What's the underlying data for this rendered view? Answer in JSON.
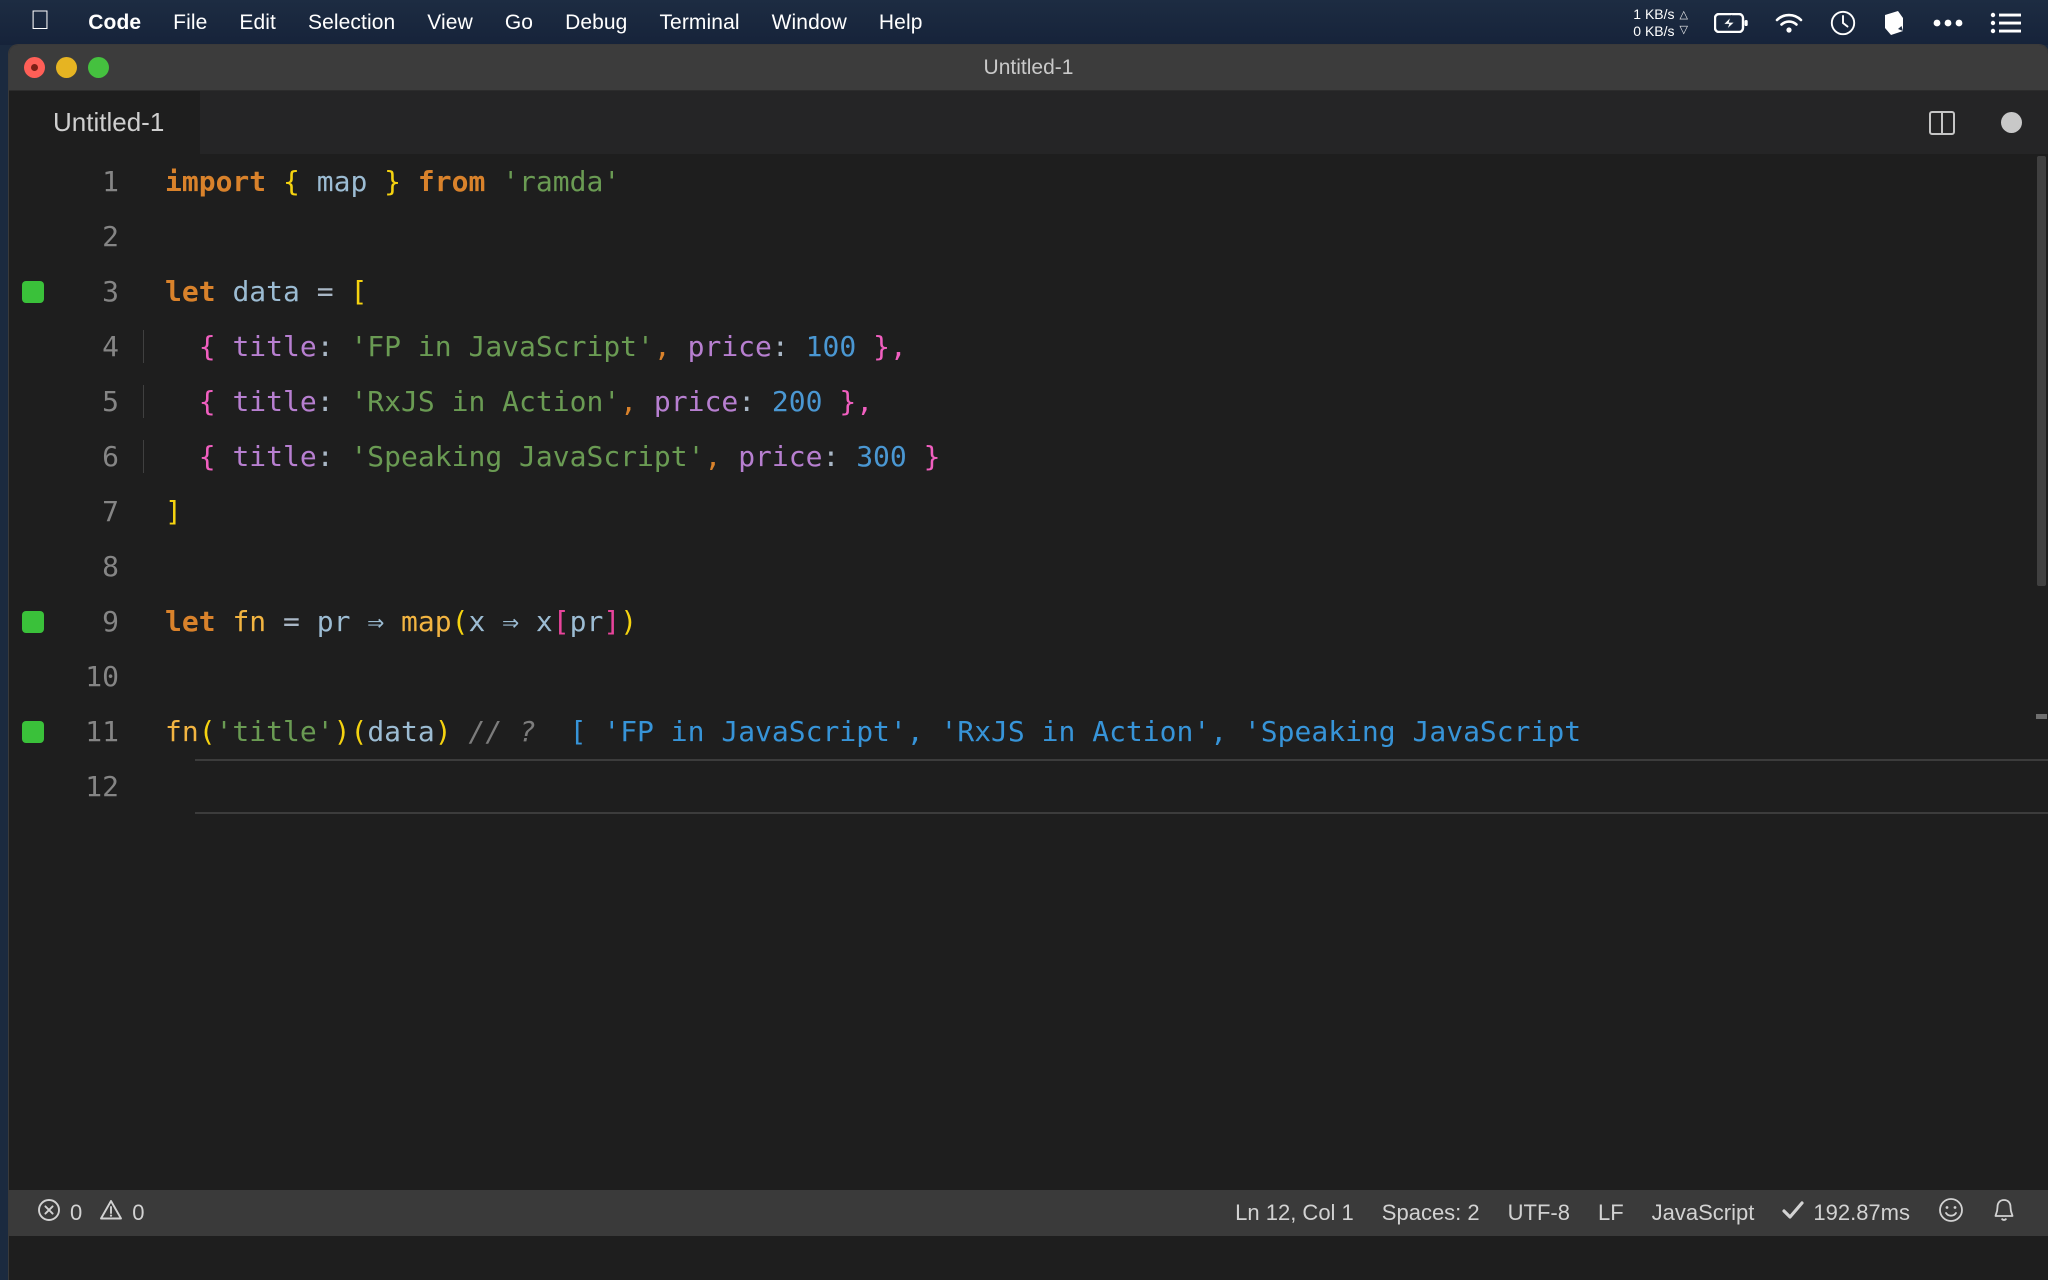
{
  "menubar": {
    "apple_icon": "apple-logo-icon",
    "items": [
      {
        "label": "Code",
        "bold": true
      },
      {
        "label": "File",
        "bold": false
      },
      {
        "label": "Edit",
        "bold": false
      },
      {
        "label": "Selection",
        "bold": false
      },
      {
        "label": "View",
        "bold": false
      },
      {
        "label": "Go",
        "bold": false
      },
      {
        "label": "Debug",
        "bold": false
      },
      {
        "label": "Terminal",
        "bold": false
      },
      {
        "label": "Window",
        "bold": false
      },
      {
        "label": "Help",
        "bold": false
      }
    ],
    "network": {
      "upload": "1 KB/s",
      "download": "0 KB/s",
      "up_arrow": "△",
      "down_arrow": "▽"
    },
    "tray_icons": [
      "battery-charging-icon",
      "wifi-icon",
      "clock-icon",
      "cube-icon",
      "ellipsis-icon",
      "list-menu-icon"
    ]
  },
  "window": {
    "title": "Untitled-1",
    "traffic_lights": [
      "close-button",
      "minimize-button",
      "zoom-button"
    ]
  },
  "tabs": {
    "active": "Untitled-1",
    "actions": [
      "split-editor-icon",
      "unsaved-indicator"
    ]
  },
  "editor": {
    "lines": [
      {
        "num": "1",
        "breakpoint": false,
        "indent_guide": false,
        "tokens": [
          {
            "text": "import",
            "cls": "t-kw"
          },
          {
            "text": " ",
            "cls": "t-punct"
          },
          {
            "text": "{",
            "cls": "t-brace-y"
          },
          {
            "text": " ",
            "cls": "t-punct"
          },
          {
            "text": "map",
            "cls": "t-var"
          },
          {
            "text": " ",
            "cls": "t-punct"
          },
          {
            "text": "}",
            "cls": "t-brace-y"
          },
          {
            "text": " ",
            "cls": "t-punct"
          },
          {
            "text": "from",
            "cls": "t-kw"
          },
          {
            "text": " ",
            "cls": "t-punct"
          },
          {
            "text": "'ramda'",
            "cls": "t-str"
          }
        ]
      },
      {
        "num": "2",
        "breakpoint": false,
        "indent_guide": false,
        "tokens": []
      },
      {
        "num": "3",
        "breakpoint": true,
        "indent_guide": false,
        "tokens": [
          {
            "text": "let",
            "cls": "t-kw"
          },
          {
            "text": " ",
            "cls": "t-punct"
          },
          {
            "text": "data",
            "cls": "t-var"
          },
          {
            "text": " ",
            "cls": "t-punct"
          },
          {
            "text": "=",
            "cls": "t-punct"
          },
          {
            "text": " ",
            "cls": "t-punct"
          },
          {
            "text": "[",
            "cls": "t-brace-y"
          }
        ]
      },
      {
        "num": "4",
        "breakpoint": false,
        "indent_guide": true,
        "tokens": [
          {
            "text": "  ",
            "cls": "t-punct"
          },
          {
            "text": "{",
            "cls": "t-brace-p"
          },
          {
            "text": " ",
            "cls": "t-punct"
          },
          {
            "text": "title",
            "cls": "t-prop"
          },
          {
            "text": ":",
            "cls": "t-punct"
          },
          {
            "text": " ",
            "cls": "t-punct"
          },
          {
            "text": "'FP in JavaScript'",
            "cls": "t-str"
          },
          {
            "text": ",",
            "cls": "t-comma-o"
          },
          {
            "text": " ",
            "cls": "t-punct"
          },
          {
            "text": "price",
            "cls": "t-prop"
          },
          {
            "text": ":",
            "cls": "t-punct"
          },
          {
            "text": " ",
            "cls": "t-punct"
          },
          {
            "text": "100",
            "cls": "t-num"
          },
          {
            "text": " ",
            "cls": "t-punct"
          },
          {
            "text": "}",
            "cls": "t-brace-p"
          },
          {
            "text": ",",
            "cls": "t-brace-p"
          }
        ]
      },
      {
        "num": "5",
        "breakpoint": false,
        "indent_guide": true,
        "tokens": [
          {
            "text": "  ",
            "cls": "t-punct"
          },
          {
            "text": "{",
            "cls": "t-brace-p"
          },
          {
            "text": " ",
            "cls": "t-punct"
          },
          {
            "text": "title",
            "cls": "t-prop"
          },
          {
            "text": ":",
            "cls": "t-punct"
          },
          {
            "text": " ",
            "cls": "t-punct"
          },
          {
            "text": "'RxJS in Action'",
            "cls": "t-str"
          },
          {
            "text": ",",
            "cls": "t-comma-o"
          },
          {
            "text": " ",
            "cls": "t-punct"
          },
          {
            "text": "price",
            "cls": "t-prop"
          },
          {
            "text": ":",
            "cls": "t-punct"
          },
          {
            "text": " ",
            "cls": "t-punct"
          },
          {
            "text": "200",
            "cls": "t-num"
          },
          {
            "text": " ",
            "cls": "t-punct"
          },
          {
            "text": "}",
            "cls": "t-brace-p"
          },
          {
            "text": ",",
            "cls": "t-brace-p"
          }
        ]
      },
      {
        "num": "6",
        "breakpoint": false,
        "indent_guide": true,
        "tokens": [
          {
            "text": "  ",
            "cls": "t-punct"
          },
          {
            "text": "{",
            "cls": "t-brace-p"
          },
          {
            "text": " ",
            "cls": "t-punct"
          },
          {
            "text": "title",
            "cls": "t-prop"
          },
          {
            "text": ":",
            "cls": "t-punct"
          },
          {
            "text": " ",
            "cls": "t-punct"
          },
          {
            "text": "'Speaking JavaScript'",
            "cls": "t-str"
          },
          {
            "text": ",",
            "cls": "t-comma-o"
          },
          {
            "text": " ",
            "cls": "t-punct"
          },
          {
            "text": "price",
            "cls": "t-prop"
          },
          {
            "text": ":",
            "cls": "t-punct"
          },
          {
            "text": " ",
            "cls": "t-punct"
          },
          {
            "text": "300",
            "cls": "t-num"
          },
          {
            "text": " ",
            "cls": "t-punct"
          },
          {
            "text": "}",
            "cls": "t-brace-p"
          }
        ]
      },
      {
        "num": "7",
        "breakpoint": false,
        "indent_guide": false,
        "tokens": [
          {
            "text": "]",
            "cls": "t-brace-y"
          }
        ]
      },
      {
        "num": "8",
        "breakpoint": false,
        "indent_guide": false,
        "tokens": []
      },
      {
        "num": "9",
        "breakpoint": true,
        "indent_guide": false,
        "tokens": [
          {
            "text": "let",
            "cls": "t-kw"
          },
          {
            "text": " ",
            "cls": "t-punct"
          },
          {
            "text": "fn",
            "cls": "t-fn"
          },
          {
            "text": " ",
            "cls": "t-punct"
          },
          {
            "text": "=",
            "cls": "t-punct"
          },
          {
            "text": " ",
            "cls": "t-punct"
          },
          {
            "text": "pr",
            "cls": "t-var"
          },
          {
            "text": " ",
            "cls": "t-punct"
          },
          {
            "text": "⇒",
            "cls": "t-var"
          },
          {
            "text": " ",
            "cls": "t-punct"
          },
          {
            "text": "map",
            "cls": "t-fn"
          },
          {
            "text": "(",
            "cls": "t-brace-y"
          },
          {
            "text": "x",
            "cls": "t-var"
          },
          {
            "text": " ",
            "cls": "t-punct"
          },
          {
            "text": "⇒",
            "cls": "t-var"
          },
          {
            "text": " ",
            "cls": "t-punct"
          },
          {
            "text": "x",
            "cls": "t-var"
          },
          {
            "text": "[",
            "cls": "t-brace-m"
          },
          {
            "text": "pr",
            "cls": "t-var"
          },
          {
            "text": "]",
            "cls": "t-brace-m"
          },
          {
            "text": ")",
            "cls": "t-brace-y"
          }
        ]
      },
      {
        "num": "10",
        "breakpoint": false,
        "indent_guide": false,
        "tokens": []
      },
      {
        "num": "11",
        "breakpoint": true,
        "indent_guide": false,
        "tokens": [
          {
            "text": "fn",
            "cls": "t-fn"
          },
          {
            "text": "(",
            "cls": "t-brace-y"
          },
          {
            "text": "'title'",
            "cls": "t-str"
          },
          {
            "text": ")",
            "cls": "t-brace-y"
          },
          {
            "text": "(",
            "cls": "t-brace-y"
          },
          {
            "text": "data",
            "cls": "t-var"
          },
          {
            "text": ")",
            "cls": "t-brace-y"
          },
          {
            "text": " ",
            "cls": "t-punct"
          },
          {
            "text": "// ?",
            "cls": "t-comment"
          },
          {
            "text": "  ",
            "cls": "t-punct"
          },
          {
            "text": "[ 'FP in JavaScript', 'RxJS in Action', 'Speaking JavaScript",
            "cls": "t-result"
          }
        ]
      },
      {
        "num": "12",
        "breakpoint": false,
        "indent_guide": false,
        "cursor_line": true,
        "tokens": []
      }
    ]
  },
  "statusbar": {
    "errors_icon": "error-circle-icon",
    "errors": "0",
    "warnings_icon": "warning-triangle-icon",
    "warnings": "0",
    "cursor_position": "Ln 12, Col 1",
    "indentation": "Spaces: 2",
    "encoding": "UTF-8",
    "line_endings": "LF",
    "language": "JavaScript",
    "run_status_icon": "checkmark-icon",
    "run_status": "192.87ms",
    "feedback_icon": "smiley-icon",
    "notifications_icon": "bell-icon"
  }
}
